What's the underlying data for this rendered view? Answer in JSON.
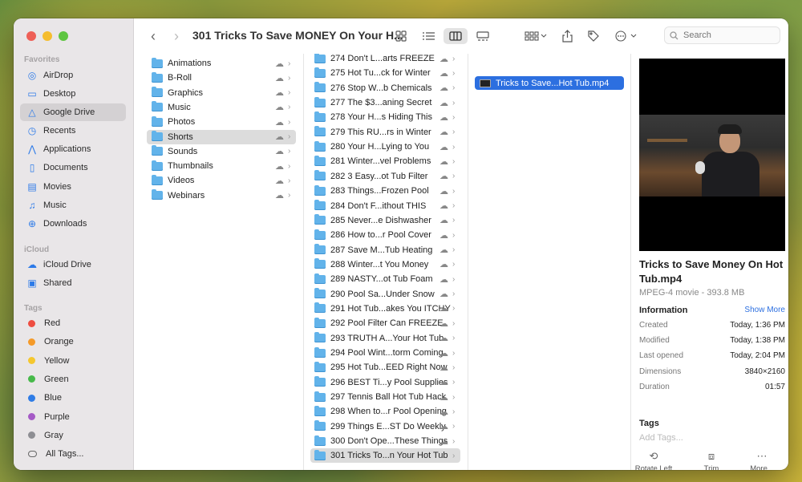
{
  "window": {
    "title": "301 Tricks To Save MONEY On Your H..."
  },
  "sidebar": {
    "favorites_label": "Favorites",
    "favorites": [
      {
        "label": "AirDrop",
        "icon": "airdrop-icon",
        "glyph": "◎"
      },
      {
        "label": "Desktop",
        "icon": "desktop-icon",
        "glyph": "▭"
      },
      {
        "label": "Google Drive",
        "icon": "google-drive-icon",
        "glyph": "△",
        "selected": true
      },
      {
        "label": "Recents",
        "icon": "clock-icon",
        "glyph": "◷"
      },
      {
        "label": "Applications",
        "icon": "applications-icon",
        "glyph": "⋀"
      },
      {
        "label": "Documents",
        "icon": "document-icon",
        "glyph": "▯"
      },
      {
        "label": "Movies",
        "icon": "film-icon",
        "glyph": "▤"
      },
      {
        "label": "Music",
        "icon": "music-icon",
        "glyph": "♫"
      },
      {
        "label": "Downloads",
        "icon": "download-icon",
        "glyph": "⊕"
      }
    ],
    "icloud_label": "iCloud",
    "icloud": [
      {
        "label": "iCloud Drive",
        "icon": "icloud-icon",
        "glyph": "☁"
      },
      {
        "label": "Shared",
        "icon": "shared-folder-icon",
        "glyph": "▣"
      }
    ],
    "tags_label": "Tags",
    "tags": [
      {
        "label": "Red",
        "color": "#ee4d41"
      },
      {
        "label": "Orange",
        "color": "#f59a29"
      },
      {
        "label": "Yellow",
        "color": "#f5c72f"
      },
      {
        "label": "Green",
        "color": "#47b94a"
      },
      {
        "label": "Blue",
        "color": "#2f7ce6"
      },
      {
        "label": "Purple",
        "color": "#a55ac6"
      },
      {
        "label": "Gray",
        "color": "#8e8e93"
      },
      {
        "label": "All Tags...",
        "color": ""
      }
    ]
  },
  "toolbar": {
    "search_placeholder": "Search"
  },
  "column1": {
    "items": [
      "Animations",
      "B-Roll",
      "Graphics",
      "Music",
      "Photos",
      "Shorts",
      "Sounds",
      "Thumbnails",
      "Videos",
      "Webinars"
    ],
    "selected_index": 5
  },
  "column2": {
    "items": [
      "274 Don't L...arts FREEZE",
      "275 Hot Tu...ck for Winter",
      "276 Stop W...b Chemicals",
      "277 The $3...aning Secret",
      "278 Your H...s Hiding This",
      "279 This RU...rs in Winter",
      "280 Your H...Lying to You",
      "281 Winter...vel Problems",
      "282 3 Easy...ot Tub Filter",
      "283 Things...Frozen Pool",
      "284 Don't F...ithout THIS",
      "285 Never...e Dishwasher",
      "286 How to...r Pool Cover",
      "287 Save M...Tub Heating",
      "288 Winter...t You Money",
      "289 NASTY...ot Tub Foam",
      "290 Pool Sa...Under Snow",
      "291 Hot Tub...akes You ITCHY",
      "292 Pool Filter Can FREEZE",
      "293 TRUTH A...Your Hot Tub",
      "294 Pool Wint...torm Coming",
      "295 Hot Tub...EED Right Now",
      "296 BEST Ti...y Pool Supplies",
      "297 Tennis Ball Hot Tub Hack",
      "298 When to...r Pool Opening",
      "299 Things E...ST Do Weekly",
      "300 Don't Ope...These Things",
      "301 Tricks To...n Your Hot Tub"
    ],
    "selected_index": 27
  },
  "column3": {
    "file": "Tricks to Save...Hot Tub.mp4"
  },
  "preview": {
    "title": "Tricks to Save Money On Hot Tub.mp4",
    "subtitle": "MPEG-4 movie - 393.8 MB",
    "information_label": "Information",
    "show_more": "Show More",
    "info": [
      {
        "key": "Created",
        "value": "Today, 1:36 PM"
      },
      {
        "key": "Modified",
        "value": "Today, 1:38 PM"
      },
      {
        "key": "Last opened",
        "value": "Today, 2:04 PM"
      },
      {
        "key": "Dimensions",
        "value": "3840×2160"
      },
      {
        "key": "Duration",
        "value": "01:57"
      }
    ],
    "tags_label": "Tags",
    "add_tags": "Add Tags...",
    "actions": [
      {
        "label": "Rotate Left",
        "icon": "rotate-left-icon",
        "glyph": "⟲"
      },
      {
        "label": "Trim",
        "icon": "trim-icon",
        "glyph": "⧈"
      },
      {
        "label": "More...",
        "icon": "more-icon",
        "glyph": "⋯"
      }
    ]
  }
}
